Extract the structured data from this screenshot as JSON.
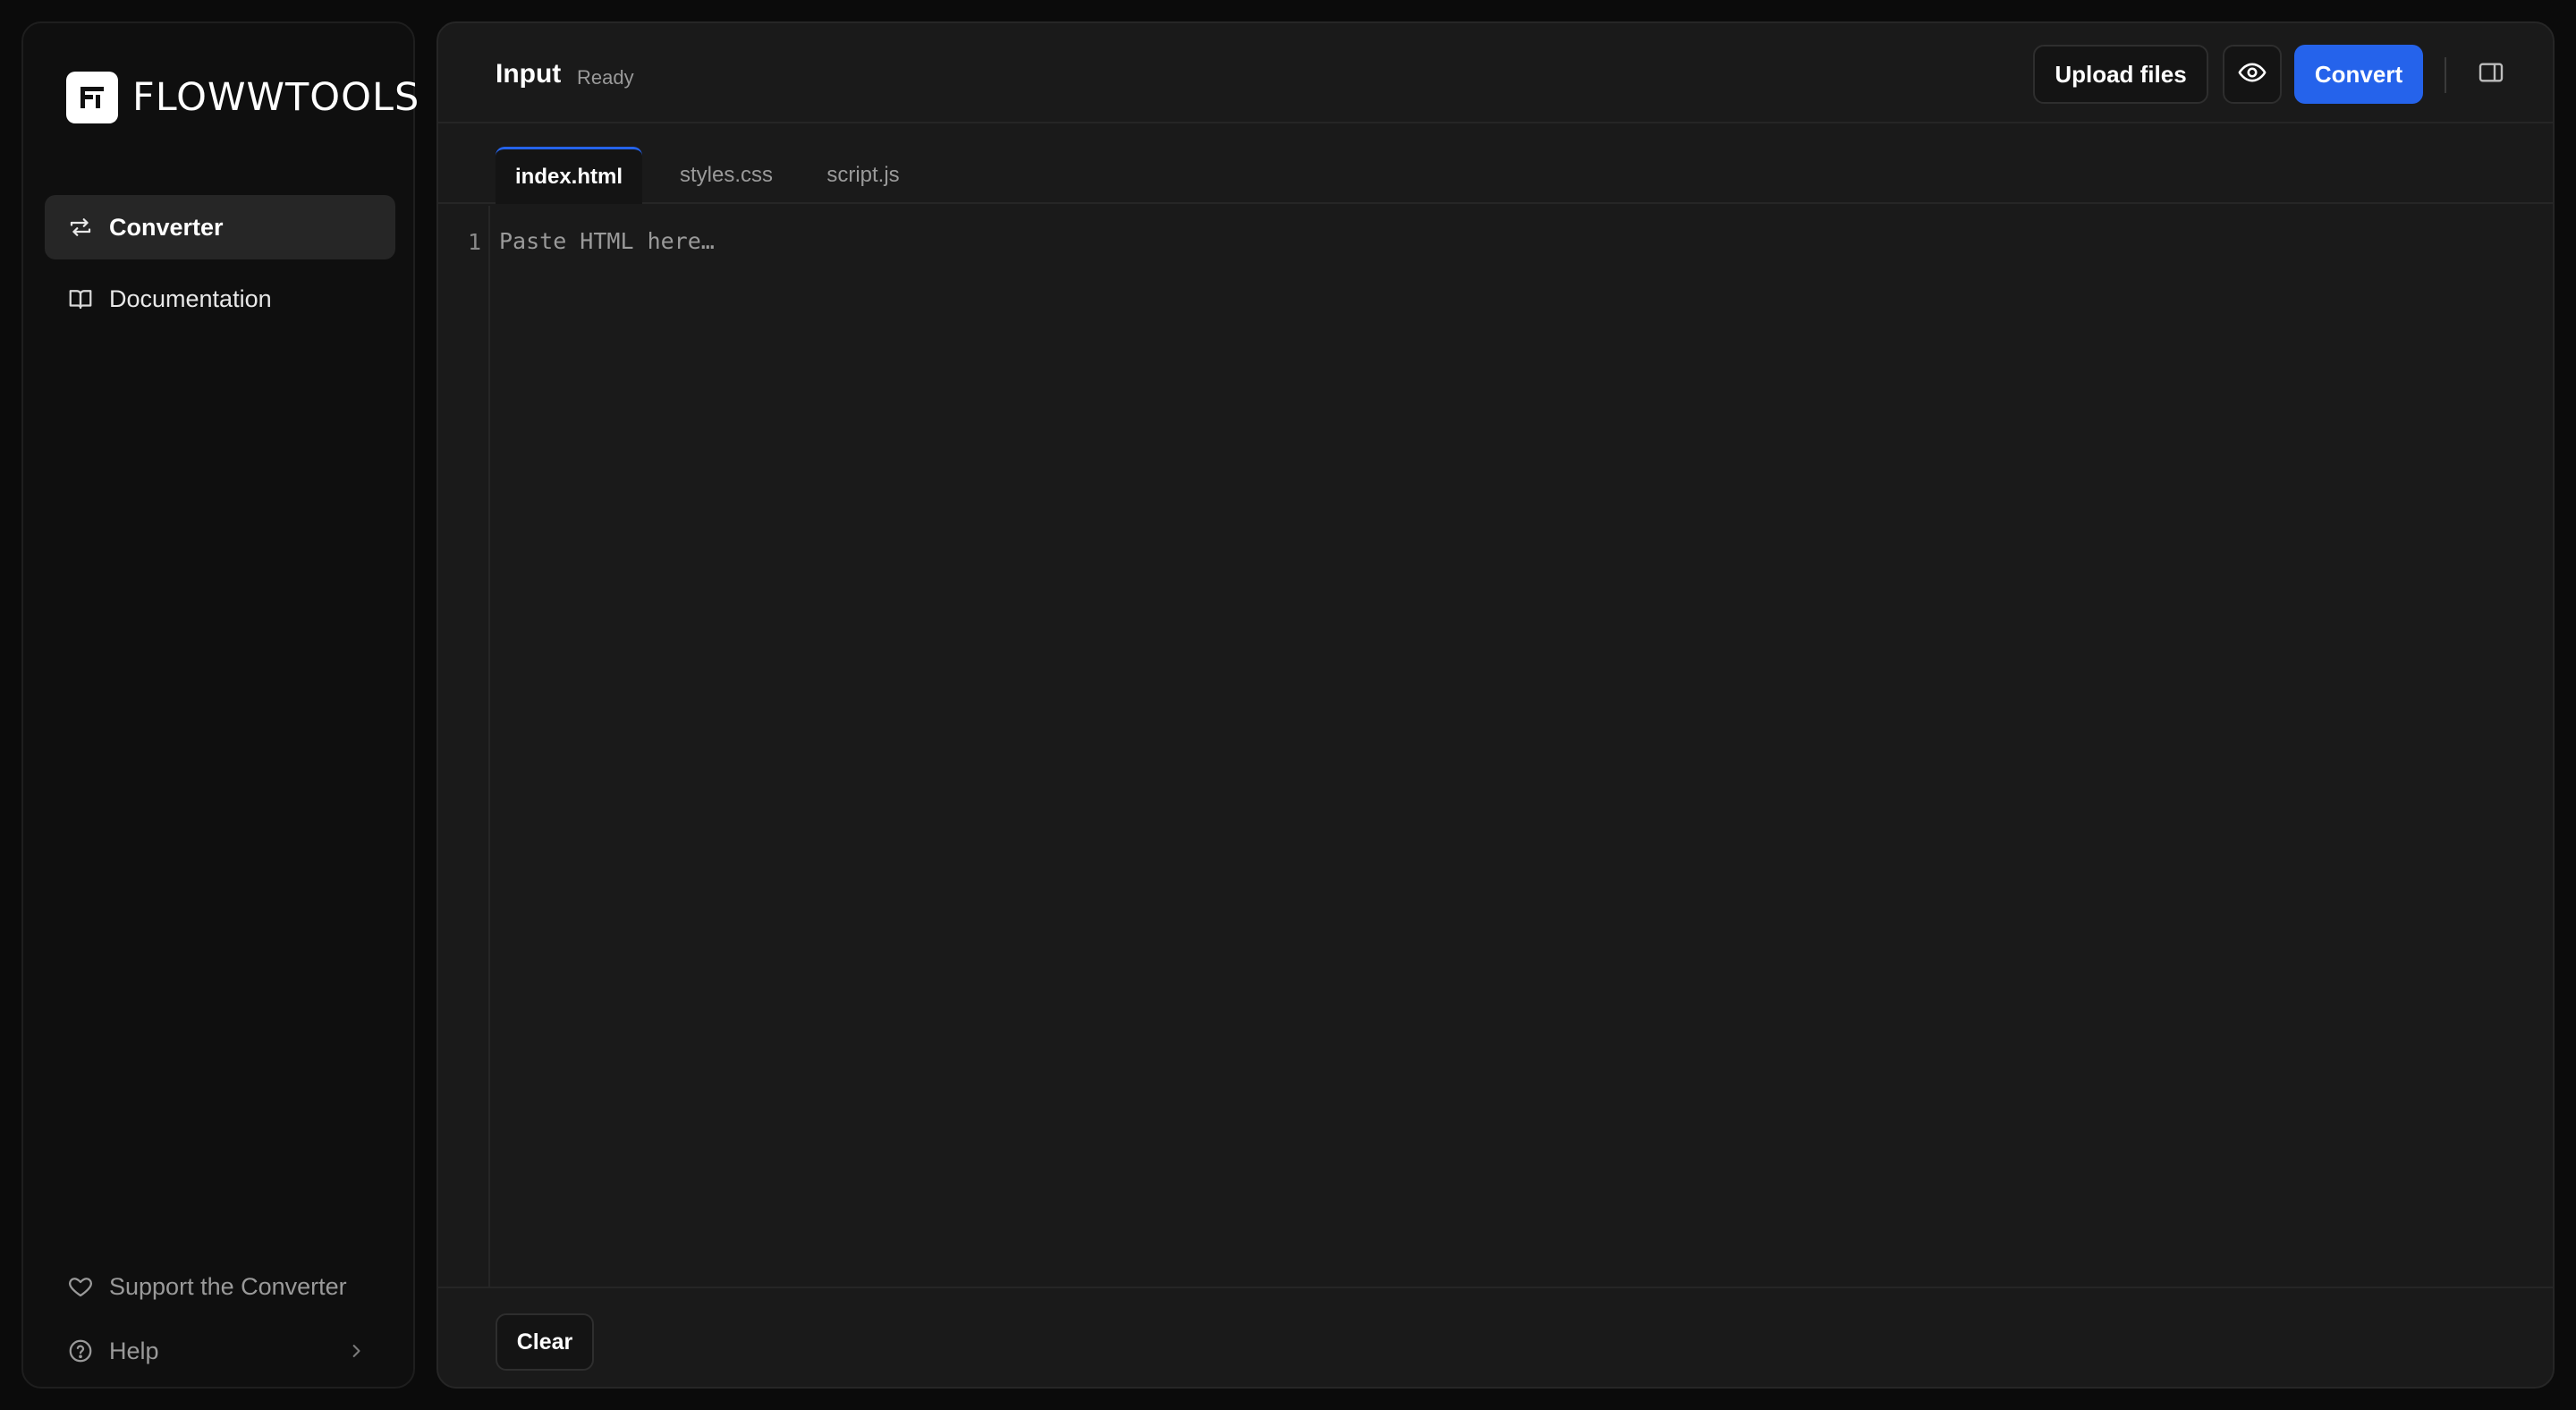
{
  "app": {
    "logo_text": "FLOWWTOOLS",
    "logo_icon": "flowwtools-logo-icon"
  },
  "sidebar": {
    "items": [
      {
        "label": "Converter",
        "icon": "swap-arrows-icon",
        "active": true
      },
      {
        "label": "Documentation",
        "icon": "book-open-icon",
        "active": false
      }
    ],
    "bottom": {
      "support_label": "Support the Converter",
      "support_icon": "heart-icon",
      "help_label": "Help",
      "help_icon": "help-circle-icon",
      "help_chevron": "chevron-right-icon"
    }
  },
  "header": {
    "title": "Input",
    "status": "Ready",
    "upload_label": "Upload files",
    "preview_icon": "eye-icon",
    "convert_label": "Convert",
    "panel_icon": "sidebar-panel-icon"
  },
  "tabs": [
    {
      "label": "index.html",
      "active": true
    },
    {
      "label": "styles.css",
      "active": false
    },
    {
      "label": "script.js",
      "active": false
    }
  ],
  "editor": {
    "line_number": "1",
    "placeholder": "Paste HTML here…",
    "value": ""
  },
  "footer": {
    "clear_label": "Clear"
  },
  "colors": {
    "accent": "#2563eb",
    "background": "#0b0b0b",
    "panel": "#1a1a1a",
    "sidebar": "#0f0f0f"
  }
}
